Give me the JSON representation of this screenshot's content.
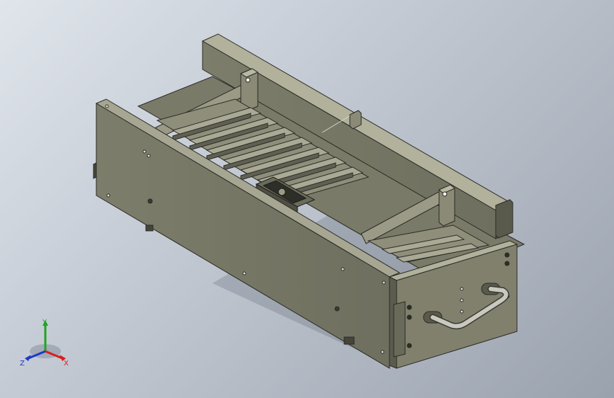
{
  "viewport": {
    "background_top": "#e0e5ec",
    "background_bottom": "#9aa2ae"
  },
  "model": {
    "part_color": "#8f8f7b",
    "edge_color": "#2a2a26"
  },
  "triad": {
    "x_label": "X",
    "y_label": "Y",
    "z_label": "Z",
    "x_color": "#d81e1e",
    "y_color": "#1fa51f",
    "z_color": "#1c39c8"
  }
}
